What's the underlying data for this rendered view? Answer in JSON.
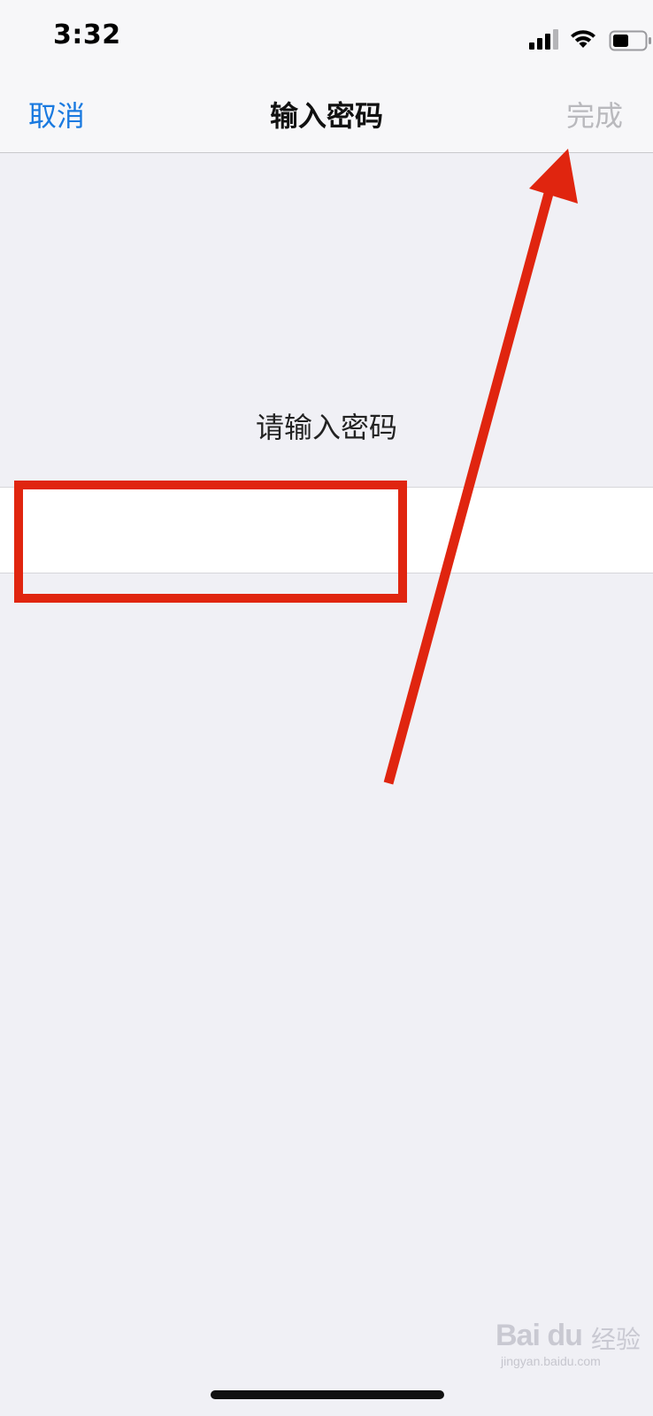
{
  "status_bar": {
    "time": "3:32"
  },
  "nav": {
    "cancel_label": "取消",
    "title": "输入密码",
    "done_label": "完成"
  },
  "main": {
    "prompt": "请输入密码",
    "password_value": ""
  },
  "watermark": {
    "logo_text": "Bai du",
    "logo_text_cn": "经验",
    "url": "jingyan.baidu.com"
  },
  "colors": {
    "link_blue": "#1a7ae0",
    "disabled_gray": "#b9b9bd",
    "annotation_red": "#e0250f",
    "background": "#f0f0f5"
  }
}
